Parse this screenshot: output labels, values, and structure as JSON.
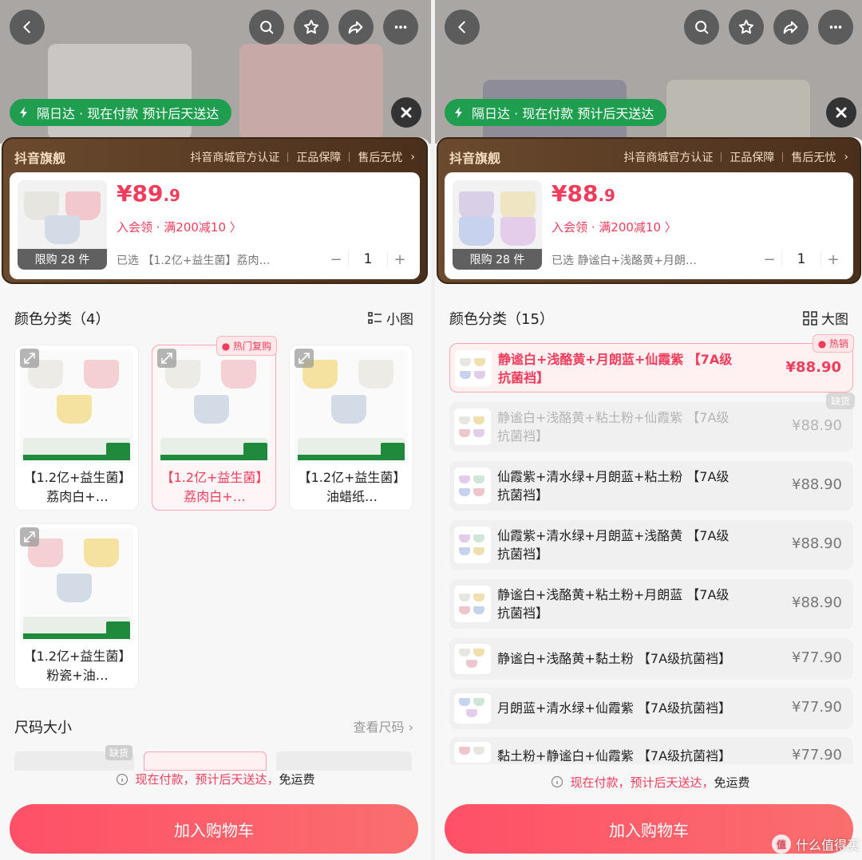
{
  "left": {
    "delivery": "隔日达 · 现在付款 预计后天送达",
    "brand": {
      "name": "抖音旗舰",
      "badges": [
        "抖音商城官方认证",
        "正品保障",
        "售后无忧"
      ]
    },
    "product": {
      "price_main": "¥89",
      "price_decimal": ".9",
      "coupon": "入会领 · 满200减10 〉",
      "limit": "限购 28 件",
      "selected": "已选 【1.2亿+益生菌】荔肉…",
      "quantity": "1"
    },
    "color_section": {
      "title": "颜色分类（4）",
      "toggle": "小图"
    },
    "grid": [
      {
        "label": "【1.2亿+益生菌】荔肉白+…",
        "hot": ""
      },
      {
        "label": "【1.2亿+益生菌】荔肉白+…",
        "hot": "热门复购"
      },
      {
        "label": "【1.2亿+益生菌】油蜡纸…",
        "hot": ""
      },
      {
        "label": "【1.2亿+益生菌】粉瓷+油…",
        "hot": ""
      }
    ],
    "size_section": {
      "title": "尺码大小",
      "link": "查看尺码",
      "out_of_stock": "缺货"
    },
    "notice_red": "现在付款，预计后天送达，",
    "notice_black": "免运费",
    "cart_button": "加入购物车"
  },
  "right": {
    "delivery": "隔日达 · 现在付款 预计后天送达",
    "brand": {
      "name": "抖音旗舰",
      "badges": [
        "抖音商城官方认证",
        "正品保障",
        "售后无忧"
      ]
    },
    "product": {
      "price_main": "¥88",
      "price_decimal": ".9",
      "coupon": "入会领 · 满200减10 〉",
      "limit": "限购 28 件",
      "selected": "已选 静谧白+浅酪黄+月朗…",
      "quantity": "1"
    },
    "color_section": {
      "title": "颜色分类（15）",
      "toggle": "大图"
    },
    "list": [
      {
        "text": "静谧白+浅酪黄+月朗蓝+仙霞紫 【7A级抗菌裆】",
        "price": "¥88.90",
        "badge": "热销",
        "state": "active"
      },
      {
        "text": "静谧白+浅酪黄+粘土粉+仙霞紫 【7A级抗菌裆】",
        "price": "¥88.90",
        "badge": "缺货",
        "state": "disabled"
      },
      {
        "text": "仙霞紫+清水绿+月朗蓝+粘土粉 【7A级抗菌裆】",
        "price": "¥88.90",
        "badge": "",
        "state": ""
      },
      {
        "text": "仙霞紫+清水绿+月朗蓝+浅酪黄 【7A级抗菌裆】",
        "price": "¥88.90",
        "badge": "",
        "state": ""
      },
      {
        "text": "静谧白+浅酪黄+粘土粉+月朗蓝 【7A级抗菌裆】",
        "price": "¥88.90",
        "badge": "",
        "state": ""
      },
      {
        "text": "静谧白+浅酪黄+黏土粉 【7A级抗菌裆】",
        "price": "¥77.90",
        "badge": "",
        "state": ""
      },
      {
        "text": "月朗蓝+清水绿+仙霞紫 【7A级抗菌裆】",
        "price": "¥77.90",
        "badge": "",
        "state": ""
      },
      {
        "text": "黏土粉+静谧白+仙霞紫 【7A级抗菌裆】",
        "price": "¥77.90",
        "badge": "",
        "state": ""
      }
    ],
    "notice_red": "现在付款，预计后天送达，",
    "notice_black": "免运费",
    "cart_button": "加入购物车"
  },
  "watermark": "什么值得买",
  "colors": {
    "accent": "#f23c5b",
    "green": "#1f9e50",
    "brand_bg": "#5a3b23"
  }
}
